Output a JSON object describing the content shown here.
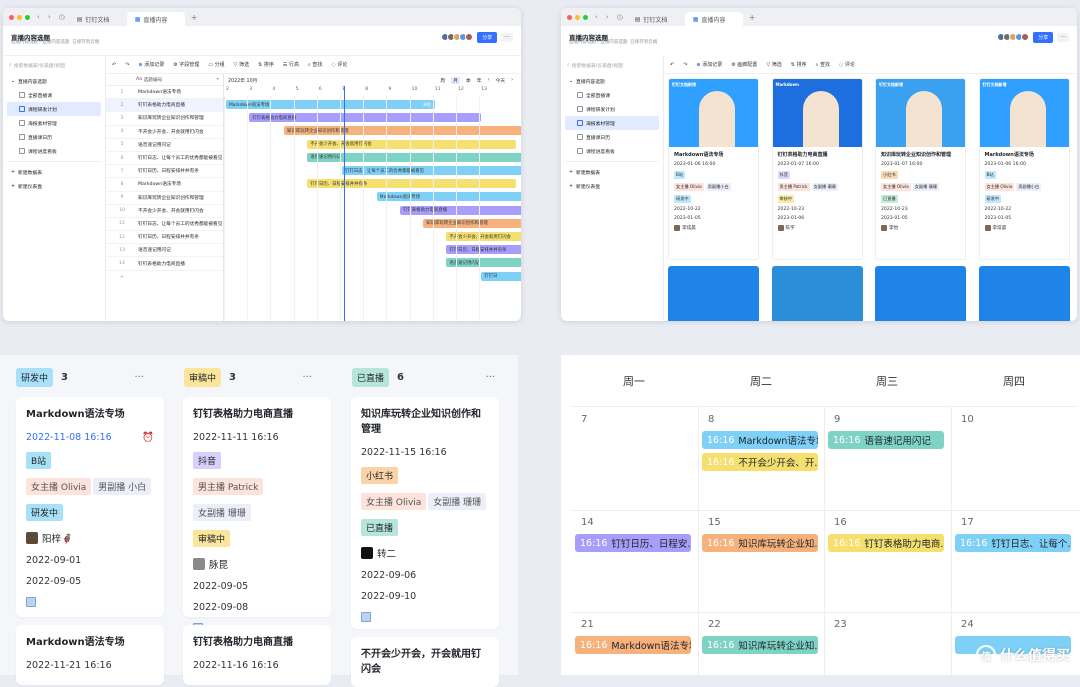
{
  "colors": {
    "accent": "#3370ff",
    "blue": "#7ed0f7",
    "purple": "#a89dfa",
    "orange": "#f7b17c",
    "yellow": "#f5df6e",
    "teal": "#7ed3c5"
  },
  "browser": {
    "tab1": "钉钉文档",
    "tab2": "直播内容",
    "plus": "+"
  },
  "header": {
    "title": "直播内容选题",
    "sub_a": "直播内容选题 / 直播内容选题",
    "sub_b": "已保存到云端",
    "share": "分享",
    "more": "···"
  },
  "sidebar": {
    "search": "搜索数据表/仪表盘/视图",
    "group": "直播内容选题",
    "itemsA": [
      "全部直播课",
      "课程研发计划",
      "海报素材管理",
      "直播课日历",
      "课程进度看板"
    ],
    "itemsB": [
      "全部直播课",
      "课程研发计划",
      "海报素材管理",
      "直播课日历",
      "课程进度看板"
    ],
    "new_table": "新建数据表",
    "new_dash": "新建仪表盘"
  },
  "toolbarA": [
    "添加记录",
    "字段管理",
    "分组",
    "筛选",
    "排序",
    "行高",
    "查找",
    "评论"
  ],
  "toolbarB": [
    "添加记录",
    "画廊配置",
    "筛选",
    "排序",
    "查找",
    "评论"
  ],
  "gantt": {
    "col_header": "选题编号",
    "month": "2022年 10月",
    "views": [
      "周",
      "月",
      "季",
      "年"
    ],
    "today": "今天",
    "days": [
      "2",
      "3",
      "4",
      "5",
      "6",
      "7",
      "8",
      "9",
      "10",
      "11",
      "12",
      "13"
    ],
    "rows": [
      "Markdown语法专场",
      "钉钉表格助力电商直播",
      "知识库玩转企业知识创作和管理",
      "不开会少开会、开会就用钉闪会",
      "语音速记用闪记",
      "钉钉日志、让每个员工的优秀都能被看见",
      "钉钉日历、日程安排井井有条",
      "Markdown语法专场",
      "知识库玩转企业知识创作和管理",
      "不开会少开会、开会就用钉闪会",
      "钉钉日志、让每个员工的优秀都能被看见",
      "钉钉日历、日程安排井井有条",
      "语音速记用闪记",
      "钉钉表格助力电商直播"
    ],
    "bars": [
      {
        "label": "Markdown语法专场",
        "start": 0,
        "len": 9,
        "color": "#7ed0f7",
        "end_label": "B站"
      },
      {
        "label": "钉钉表格助力电商直播",
        "start": 1,
        "len": 10,
        "color": "#a89dfa",
        "end_label": ""
      },
      {
        "label": "知识库玩转企业知识创作和管理",
        "start": 2.5,
        "len": 11,
        "color": "#f7b17c",
        "end_label": ""
      },
      {
        "label": "不开会少开会、开会就用钉闪会",
        "start": 3.5,
        "len": 9,
        "color": "#f5df6e",
        "end_label": ""
      },
      {
        "label": "语音速记用闪记",
        "start": 3.5,
        "len": 10,
        "color": "#7ed3c5",
        "end_label": ""
      },
      {
        "label": "钉钉日志、让每个员工的优秀都能被看见",
        "start": 5,
        "len": 9,
        "color": "#7ed0f7",
        "end_label": ""
      },
      {
        "label": "钉钉日历、日程安排井井有条",
        "start": 3.5,
        "len": 9,
        "color": "#f5df6e",
        "end_label": ""
      },
      {
        "label": "Markdown语法专场",
        "start": 6.5,
        "len": 9,
        "color": "#7ed0f7",
        "end_label": ""
      },
      {
        "label": "钉钉表格助力电商直播",
        "start": 7.5,
        "len": 9,
        "color": "#a89dfa",
        "end_label": ""
      },
      {
        "label": "知识库玩转企业知识创作和管理",
        "start": 8.5,
        "len": 9,
        "color": "#f7b17c",
        "end_label": ""
      },
      {
        "label": "不开会少开会、开会就用钉闪会",
        "start": 9.5,
        "len": 9,
        "color": "#f5df6e",
        "end_label": ""
      },
      {
        "label": "钉钉日历、日程安排井井有条",
        "start": 9.5,
        "len": 9,
        "color": "#a89dfa",
        "end_label": ""
      },
      {
        "label": "语音速记用闪记",
        "start": 9.5,
        "len": 9,
        "color": "#7ed3c5",
        "end_label": ""
      },
      {
        "label": "钉钉日",
        "start": 11,
        "len": 3,
        "color": "#7ed0f7",
        "end_label": ""
      }
    ]
  },
  "gallery": [
    {
      "title": "Markdown语法专场",
      "dt": "2023-01-06 16:00",
      "platform": "B站",
      "host1": "女主播 Olivia",
      "host2": "男副播小白",
      "status": "研发中",
      "d1": "2022-10-22",
      "d2": "2023-01-05",
      "owner": "李炫晨",
      "img_text": "钉钉文档新增",
      "bg": "#2fa0ff"
    },
    {
      "title": "钉钉表格助力电商直播",
      "dt": "2023-01-07 16:00",
      "platform": "抖音",
      "host1": "男主播 Patrick",
      "host2": "女副播 珊珊",
      "status": "审核中",
      "d1": "2022-10-23",
      "d2": "2023-01-06",
      "owner": "陈宇",
      "img_text": "Markdown",
      "bg": "#1d6fe0"
    },
    {
      "title": "知识库玩转企业知识创作和管理",
      "dt": "2023-01-07 16:00",
      "platform": "小红书",
      "host1": "女主播 Olivia",
      "host2": "女副播 珊珊",
      "status": "已直播",
      "d1": "2022-10-23",
      "d2": "2023-01-05",
      "owner": "李怡",
      "img_text": "钉钉文档新增",
      "bg": "#3aa0f0"
    },
    {
      "title": "Markdown语法专场",
      "dt": "2023-01-06 16:00",
      "platform": "B站",
      "host1": "女主播 Olivia",
      "host2": "男副播小白",
      "status": "研发中",
      "d1": "2022-10-22",
      "d2": "2023-01-05",
      "owner": "李炫晨",
      "img_text": "钉钉文档新增",
      "bg": "#2fa0ff"
    }
  ],
  "kanban": {
    "cols": [
      {
        "badge": "研发中",
        "count": "3",
        "more": "···"
      },
      {
        "badge": "审稿中",
        "count": "3",
        "more": "···"
      },
      {
        "badge": "已直播",
        "count": "6",
        "more": "···"
      }
    ],
    "cards": [
      {
        "title": "Markdown语法专场",
        "date": "2022-11-08 16:16",
        "platform": "B站",
        "host1": "女主播 Olivia",
        "host2": "男副播 小白",
        "status": "研发中",
        "person": "阳梓🦸",
        "d1": "2022-09-01",
        "d2": "2022-09-05"
      },
      {
        "title": "钉钉表格助力电商直播",
        "date": "2022-11-11 16:16",
        "platform": "抖音",
        "host1": "男主播 Patrick",
        "host2": "女副播 珊珊",
        "status": "审稿中",
        "person": "脉昆",
        "d1": "2022-09-05",
        "d2": "2022-09-08"
      },
      {
        "title": "知识库玩转企业知识创作和管理",
        "date": "2022-11-15 16:16",
        "platform": "小红书",
        "host1": "女主播 Olivia",
        "host2": "女副播 珊珊",
        "status": "已直播",
        "person": "转二",
        "d1": "2022-09-06",
        "d2": "2022-09-10"
      }
    ],
    "cards2": [
      {
        "title": "Markdown语法专场",
        "date": "2022-11-21 16:16"
      },
      {
        "title": "钉钉表格助力电商直播",
        "date": "2022-11-16 16:16"
      },
      {
        "title": "不开会少开会，开会就用钉闪会",
        "date": ""
      }
    ]
  },
  "calendar": {
    "days": [
      "周一",
      "周二",
      "周三",
      "周四"
    ],
    "weeks": [
      [
        "7",
        "8",
        "9",
        "10"
      ],
      [
        "14",
        "15",
        "16",
        "17"
      ],
      [
        "21",
        "22",
        "23",
        "24"
      ]
    ],
    "events": [
      {
        "w": 0,
        "d": 1,
        "slot": 0,
        "time": "16:16",
        "text": "Markdown语法专场",
        "color": "#7ed0f7"
      },
      {
        "w": 0,
        "d": 1,
        "slot": 1,
        "time": "16:16",
        "text": "不开会少开会、开...",
        "color": "#f5df6e"
      },
      {
        "w": 0,
        "d": 2,
        "slot": 0,
        "time": "16:16",
        "text": "语音速记用闪记",
        "color": "#7ed3c5"
      },
      {
        "w": 1,
        "d": 0,
        "slot": 0,
        "time": "16:16",
        "text": "钉钉日历、日程安...",
        "color": "#a89dfa"
      },
      {
        "w": 1,
        "d": 1,
        "slot": 0,
        "time": "16:16",
        "text": "知识库玩转企业知...",
        "color": "#f7b17c"
      },
      {
        "w": 1,
        "d": 2,
        "slot": 0,
        "time": "16:16",
        "text": "钉钉表格助力电商...",
        "color": "#f5df6e"
      },
      {
        "w": 1,
        "d": 3,
        "slot": 0,
        "time": "16:16",
        "text": "钉钉日志、让每个...",
        "color": "#7ed0f7"
      },
      {
        "w": 2,
        "d": 0,
        "slot": 0,
        "time": "16:16",
        "text": "Markdown语法专场",
        "color": "#f7b17c"
      },
      {
        "w": 2,
        "d": 1,
        "slot": 0,
        "time": "16:16",
        "text": "知识库玩转企业知...",
        "color": "#7ed3c5"
      },
      {
        "w": 2,
        "d": 3,
        "slot": 0,
        "time": "",
        "text": "",
        "color": "#7ed0f7"
      }
    ]
  },
  "watermark": "什么值得买"
}
